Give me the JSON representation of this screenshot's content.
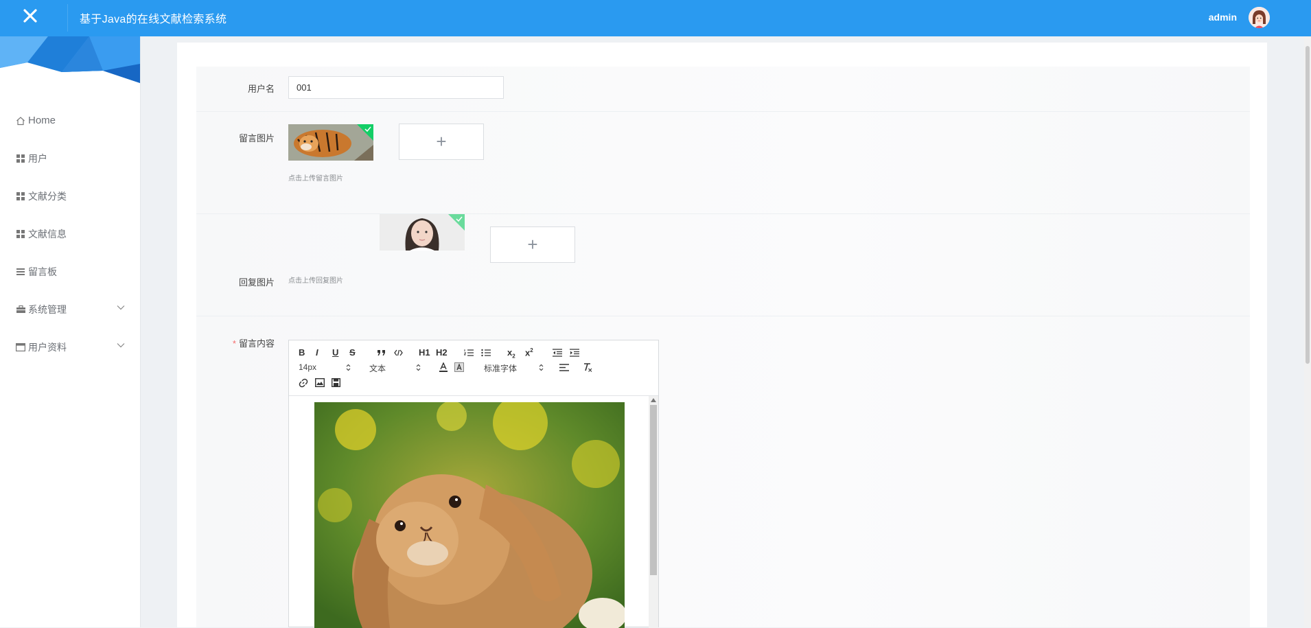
{
  "header": {
    "title": "基于Java的在线文献检索系统",
    "user": "admin"
  },
  "sidebar": {
    "items": [
      {
        "label": "Home",
        "icon": "home-icon"
      },
      {
        "label": "用户",
        "icon": "grid-icon"
      },
      {
        "label": "文献分类",
        "icon": "grid-icon"
      },
      {
        "label": "文献信息",
        "icon": "grid-icon"
      },
      {
        "label": "留言板",
        "icon": "list-icon"
      },
      {
        "label": "系统管理",
        "icon": "briefcase-icon",
        "expandable": true
      },
      {
        "label": "用户资料",
        "icon": "id-card-icon",
        "expandable": true
      }
    ]
  },
  "form": {
    "username_label": "用户名",
    "username_value": "001",
    "message_image_label": "留言图片",
    "message_image_hint": "点击上传留言图片",
    "reply_image_label": "回复图片",
    "reply_image_hint": "点击上传回复图片",
    "content_label": "留言内容",
    "upload_symbol": "+"
  },
  "editor": {
    "font_size": "14px",
    "format": "文本",
    "font_family": "标准字体",
    "h1": "H1",
    "h2": "H2"
  },
  "colors": {
    "header": "#2a9af0",
    "required": "#f56c6c"
  }
}
